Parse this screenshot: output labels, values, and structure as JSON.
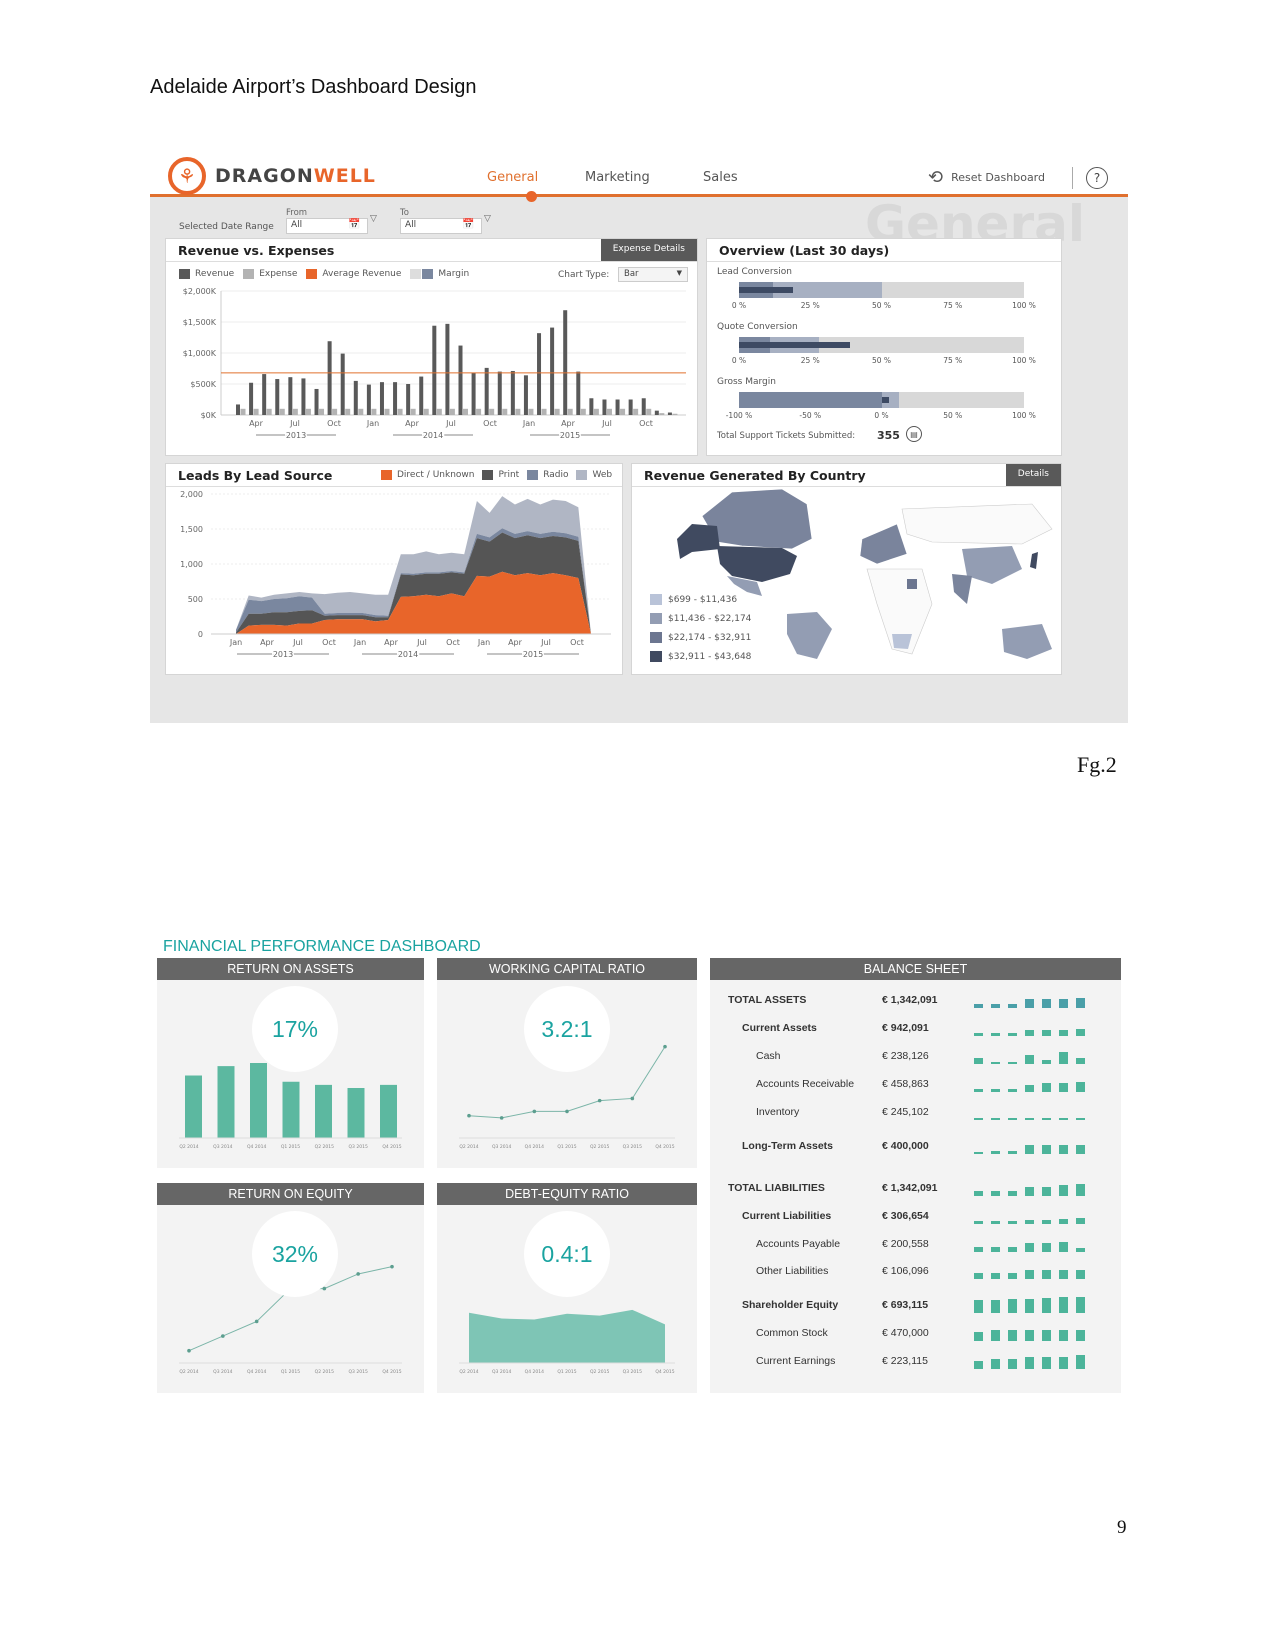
{
  "doc": {
    "title": "Adelaide Airport’s Dashboard Design",
    "caption": "Fg.2",
    "page_number": "9"
  },
  "dragonwell": {
    "brand_part1": "DRAGON",
    "brand_part2": "WELL",
    "tabs": [
      {
        "label": "General",
        "active": true
      },
      {
        "label": "Marketing",
        "active": false
      },
      {
        "label": "Sales",
        "active": false
      }
    ],
    "reset_label": "Reset Dashboard",
    "help_label": "?",
    "date_range": {
      "label": "Selected Date Range",
      "from_label": "From",
      "from_value": "All",
      "to_label": "To",
      "to_value": "All"
    },
    "watermark": "General",
    "colors": {
      "accent": "#e8652a",
      "revenue": "#595959",
      "expense": "#b3b3b3",
      "avg_line": "#e0702e"
    },
    "revenue_panel": {
      "title": "Revenue vs. Expenses",
      "button": "Expense Details",
      "legend": [
        "Revenue",
        "Expense",
        "Average Revenue",
        "Margin"
      ],
      "chart_type_label": "Chart Type:",
      "chart_type_value": "Bar"
    },
    "overview_panel": {
      "title": "Overview (Last 30 days)",
      "metrics": [
        {
          "label": "Lead Conversion",
          "ticks": [
            "0 %",
            "25 %",
            "50 %",
            "75 %",
            "100 %"
          ],
          "value_pct": 19,
          "band1_pct": 12,
          "band2_pct": 50
        },
        {
          "label": "Quote Conversion",
          "ticks": [
            "0 %",
            "25 %",
            "50 %",
            "75 %",
            "100 %"
          ],
          "value_pct": 39,
          "band1_pct": 11,
          "band2_pct": 28
        },
        {
          "label": "Gross Margin",
          "ticks": [
            "-100 %",
            "-50 %",
            "0 %",
            "50 %",
            "100 %"
          ],
          "value_pct": 5,
          "band1_pct": 0,
          "band2_pct": 12
        }
      ],
      "tickets_label": "Total Support Tickets Submitted:",
      "tickets_value": "355"
    },
    "leads_panel": {
      "title": "Leads By Lead Source",
      "legend": [
        "Direct / Unknown",
        "Print",
        "Radio",
        "Web"
      ]
    },
    "country_panel": {
      "title": "Revenue Generated By Country",
      "button": "Details",
      "legend": [
        {
          "label": "$699 - $11,436",
          "color": "#b9c3d8"
        },
        {
          "label": "$11,436 - $22,174",
          "color": "#939db3"
        },
        {
          "label": "$22,174 - $32,911",
          "color": "#6c7690"
        },
        {
          "label": "$32,911 - $43,648",
          "color": "#404a60"
        }
      ]
    }
  },
  "financial": {
    "title": "FINANCIAL PERFORMANCE DASHBOARD",
    "accent": "#1aa3a0",
    "bar_color": "#5cb8a0",
    "cards": [
      {
        "title": "RETURN ON ASSETS",
        "kpi": "17%"
      },
      {
        "title": "WORKING CAPITAL RATIO",
        "kpi": "3.2:1"
      },
      {
        "title": "RETURN ON EQUITY",
        "kpi": "32%"
      },
      {
        "title": "DEBT-EQUITY RATIO",
        "kpi": "0.4:1"
      }
    ],
    "balance_sheet": {
      "title": "BALANCE SHEET",
      "rows": [
        {
          "label": "TOTAL ASSETS",
          "value": "€  1,342,091",
          "level": 0,
          "spark": [
            4,
            4,
            4,
            9,
            9,
            9,
            10
          ]
        },
        {
          "label": "Current Assets",
          "value": "€  942,091",
          "level": 1,
          "spark": [
            3,
            3,
            3,
            6,
            6,
            6,
            7
          ]
        },
        {
          "label": "Cash",
          "value": "€  238,126",
          "level": 2,
          "spark": [
            6,
            2,
            2,
            9,
            4,
            12,
            6
          ]
        },
        {
          "label": "Accounts Receivable",
          "value": "€  458,863",
          "level": 2,
          "spark": [
            3,
            3,
            3,
            7,
            9,
            9,
            10
          ]
        },
        {
          "label": "Inventory",
          "value": "€  245,102",
          "level": 2,
          "spark": [
            2,
            2,
            2,
            2,
            2,
            2,
            2
          ]
        },
        {
          "label": "Long-Term Assets",
          "value": "€  400,000",
          "level": 1,
          "spark": [
            2,
            3,
            3,
            9,
            9,
            9,
            9
          ]
        },
        {
          "label": "TOTAL LIABILITIES",
          "value": "€  1,342,091",
          "level": 0,
          "spark": [
            5,
            5,
            5,
            9,
            9,
            11,
            12
          ]
        },
        {
          "label": "Current Liabilities",
          "value": "€  306,654",
          "level": 1,
          "spark": [
            3,
            3,
            3,
            4,
            4,
            5,
            6
          ]
        },
        {
          "label": "Accounts Payable",
          "value": "€  200,558",
          "level": 2,
          "spark": [
            5,
            5,
            5,
            9,
            9,
            10,
            4
          ]
        },
        {
          "label": "Other Liabilities",
          "value": "€  106,096",
          "level": 2,
          "spark": [
            6,
            6,
            6,
            9,
            9,
            9,
            9
          ]
        },
        {
          "label": "Shareholder Equity",
          "value": "€  693,115",
          "level": 1,
          "spark": [
            13,
            13,
            14,
            14,
            15,
            16,
            16
          ]
        },
        {
          "label": "Common Stock",
          "value": "€  470,000",
          "level": 2,
          "spark": [
            9,
            11,
            11,
            11,
            11,
            11,
            11
          ]
        },
        {
          "label": "Current Earnings",
          "value": "€  223,115",
          "level": 2,
          "spark": [
            8,
            10,
            10,
            12,
            12,
            12,
            14
          ]
        }
      ]
    }
  },
  "chart_data": [
    {
      "type": "bar",
      "title": "Revenue vs. Expenses",
      "xlabel": "",
      "ylabel": "",
      "ylim": [
        0,
        2000
      ],
      "yticks": [
        "$0K",
        "$500K",
        "$1,000K",
        "$1,500K",
        "$2,000K"
      ],
      "xticks": [
        "Apr",
        "Jul",
        "Oct",
        "Jan",
        "Apr",
        "Jul",
        "Oct",
        "Jan",
        "Apr",
        "Jul",
        "Oct"
      ],
      "year_groups": [
        "2013",
        "2014",
        "2015"
      ],
      "series": [
        {
          "name": "Revenue",
          "values": [
            170,
            520,
            660,
            580,
            610,
            590,
            420,
            1190,
            990,
            550,
            490,
            530,
            530,
            500,
            620,
            1440,
            1470,
            1120,
            680,
            760,
            700,
            710,
            640,
            1320,
            1410,
            1690,
            700,
            270,
            250,
            250,
            250,
            270,
            70,
            40
          ]
        },
        {
          "name": "Expense",
          "values": [
            100,
            100,
            100,
            100,
            100,
            100,
            100,
            100,
            100,
            100,
            100,
            100,
            100,
            100,
            100,
            100,
            100,
            100,
            100,
            100,
            100,
            100,
            100,
            100,
            100,
            100,
            100,
            100,
            100,
            100,
            100,
            100,
            30,
            20
          ]
        }
      ],
      "average_revenue": 680
    },
    {
      "type": "area",
      "title": "Leads By Lead Source",
      "ylim": [
        0,
        2000
      ],
      "yticks": [
        "0",
        "500",
        "1,000",
        "1,500",
        "2,000"
      ],
      "xticks": [
        "Jan",
        "Apr",
        "Jul",
        "Oct",
        "Jan",
        "Apr",
        "Jul",
        "Oct",
        "Jan",
        "Apr",
        "Jul",
        "Oct"
      ],
      "year_groups": [
        "2013",
        "2014",
        "2015"
      ],
      "series": [
        {
          "name": "Direct / Unknown",
          "values": [
            0,
            120,
            130,
            130,
            120,
            150,
            150,
            200,
            210,
            210,
            210,
            180,
            200,
            530,
            540,
            560,
            540,
            580,
            540,
            830,
            820,
            890,
            840,
            870,
            840,
            870,
            840,
            800,
            0
          ]
        },
        {
          "name": "Print",
          "values": [
            20,
            170,
            160,
            180,
            190,
            180,
            190,
            60,
            60,
            60,
            60,
            60,
            40,
            320,
            300,
            300,
            320,
            300,
            320,
            540,
            500,
            560,
            530,
            540,
            530,
            530,
            540,
            530,
            0
          ]
        },
        {
          "name": "Radio",
          "values": [
            40,
            200,
            180,
            190,
            200,
            210,
            180,
            30,
            30,
            30,
            30,
            30,
            20,
            20,
            20,
            20,
            20,
            20,
            20,
            60,
            60,
            60,
            60,
            60,
            60,
            60,
            60,
            60,
            0
          ]
        },
        {
          "name": "Web",
          "values": [
            0,
            60,
            50,
            60,
            70,
            60,
            60,
            280,
            290,
            300,
            280,
            290,
            300,
            270,
            280,
            300,
            260,
            260,
            260,
            470,
            350,
            460,
            420,
            460,
            420,
            460,
            460,
            420,
            0
          ]
        }
      ]
    },
    {
      "type": "bar",
      "title": "RETURN ON ASSETS",
      "categories": [
        "Q2 2014",
        "Q3 2014",
        "Q4 2014",
        "Q1 2015",
        "Q2 2015",
        "Q3 2015",
        "Q4 2015"
      ],
      "values": [
        20,
        23,
        24,
        18,
        17,
        16,
        17
      ]
    },
    {
      "type": "line",
      "title": "WORKING CAPITAL RATIO",
      "categories": [
        "Q2 2014",
        "Q3 2014",
        "Q4 2014",
        "Q1 2015",
        "Q2 2015",
        "Q3 2015",
        "Q4 2015"
      ],
      "values": [
        1.6,
        1.55,
        1.7,
        1.7,
        1.95,
        2.0,
        3.2
      ]
    },
    {
      "type": "line",
      "title": "RETURN ON EQUITY",
      "categories": [
        "Q2 2014",
        "Q3 2014",
        "Q4 2014",
        "Q1 2015",
        "Q2 2015",
        "Q3 2015",
        "Q4 2015"
      ],
      "values": [
        10,
        14,
        18,
        27,
        27,
        31,
        33
      ]
    },
    {
      "type": "area",
      "title": "DEBT-EQUITY RATIO",
      "categories": [
        "Q2 2014",
        "Q3 2014",
        "Q4 2014",
        "Q1 2015",
        "Q2 2015",
        "Q3 2015",
        "Q4 2015"
      ],
      "values": [
        0.52,
        0.46,
        0.45,
        0.51,
        0.49,
        0.55,
        0.4
      ]
    }
  ]
}
